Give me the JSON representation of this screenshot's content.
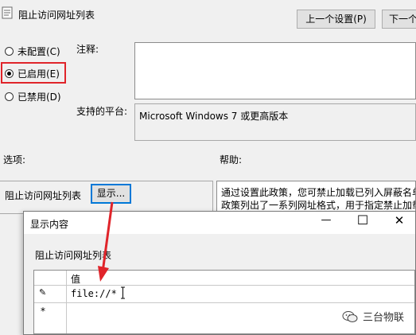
{
  "window": {
    "title": "阻止访问网址列表",
    "prev_button": "上一个设置(P)",
    "next_button": "下一个"
  },
  "options": {
    "not_configured": "未配置(C)",
    "enabled": "已启用(E)",
    "disabled": "已禁用(D)",
    "selected": "enabled"
  },
  "fields": {
    "comment_label": "注释:",
    "comment_value": "",
    "platform_label": "支持的平台:",
    "platform_value": "Microsoft Windows 7 或更高版本"
  },
  "sections": {
    "options_label": "选项:",
    "help_label": "帮助:"
  },
  "options_panel": {
    "list_label": "阻止访问网址列表",
    "show_button": "显示..."
  },
  "help_text": {
    "line1": "通过设置此政策，您可禁止加载已列入屏蔽名单",
    "line2": "政策列出了一系列网址格式，用于指定禁止加载"
  },
  "dialog": {
    "title": "显示内容",
    "minimize": "—",
    "maximize": "☐",
    "close": "✕",
    "list_label": "阻止访问网址列表",
    "column_header": "值",
    "rows": [
      {
        "marker": "✎",
        "value": "file://*"
      },
      {
        "marker": "*",
        "value": ""
      }
    ]
  },
  "watermark": {
    "text": "三台物联"
  },
  "colors": {
    "highlight_red": "#e0242a",
    "focus_blue": "#0078d7",
    "arrow_red": "#e0242a"
  }
}
